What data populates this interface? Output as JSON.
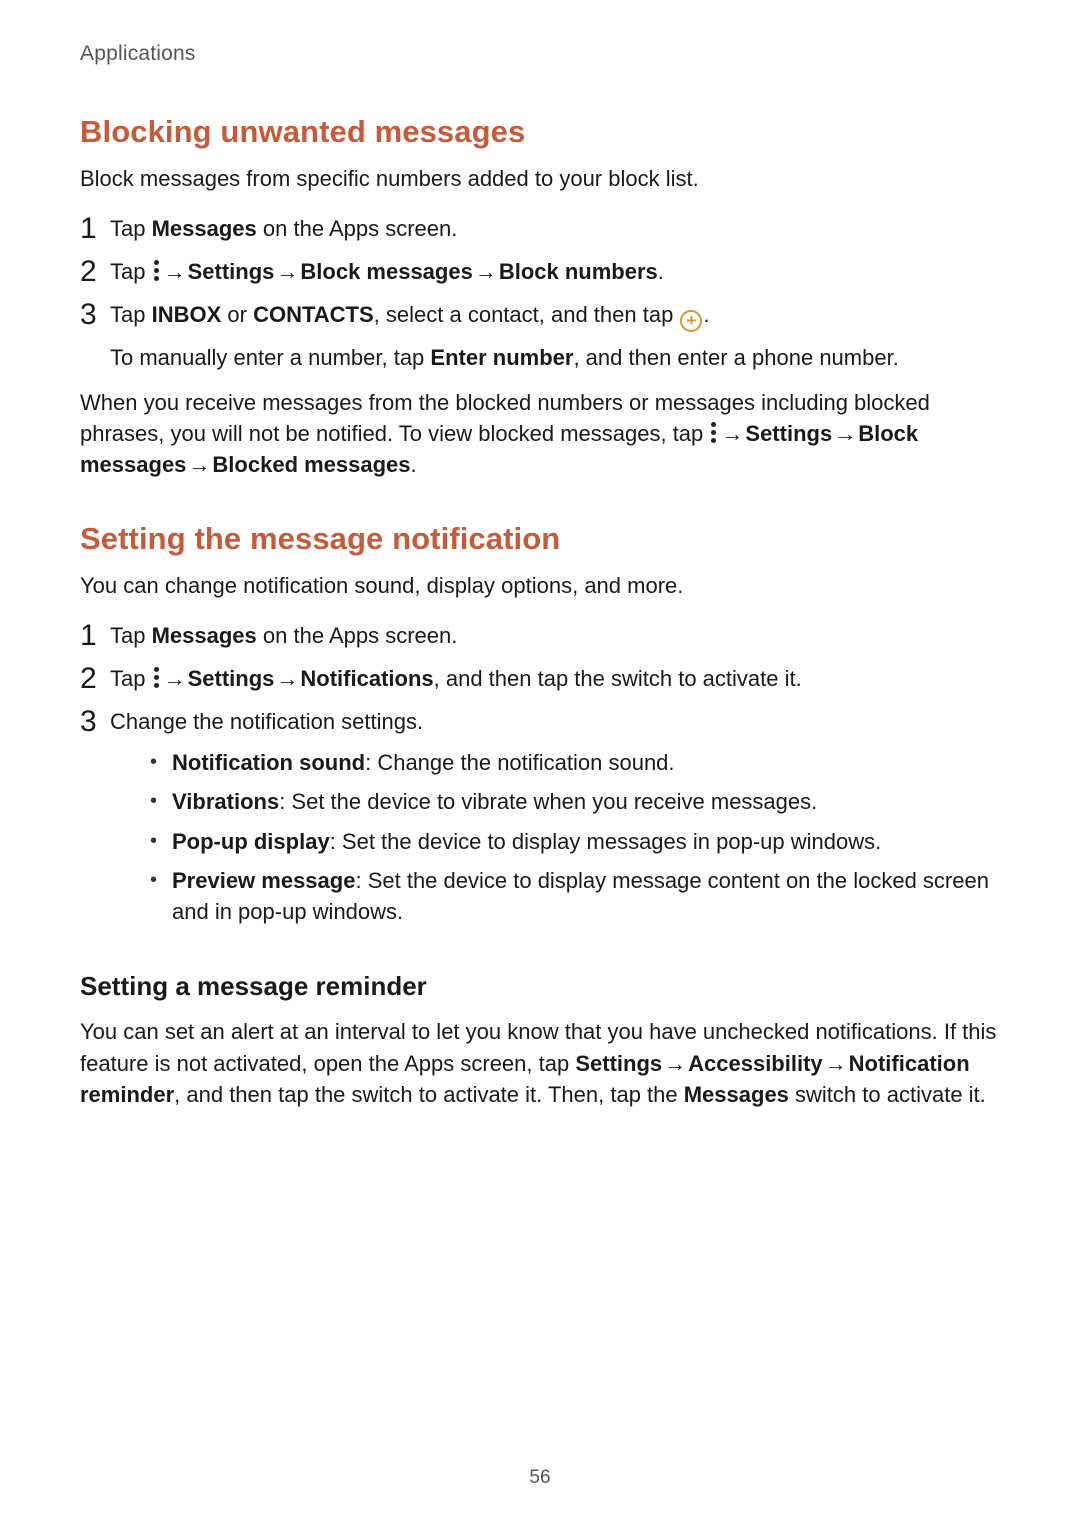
{
  "header": {
    "section": "Applications"
  },
  "section1": {
    "title": "Blocking unwanted messages",
    "lead": "Block messages from specific numbers added to your block list.",
    "step1": {
      "num": "1",
      "pre": "Tap ",
      "bold": "Messages",
      "post": " on the Apps screen."
    },
    "step2": {
      "num": "2",
      "pre": "Tap ",
      "arrow1": " → ",
      "b1": "Settings",
      "arrow2": " → ",
      "b2": "Block messages",
      "arrow3": " → ",
      "b3": "Block numbers",
      "end": "."
    },
    "step3": {
      "num": "3",
      "pre": "Tap ",
      "b1": "INBOX",
      "mid1": " or ",
      "b2": "CONTACTS",
      "mid2": ", select a contact, and then tap ",
      "end": ".",
      "sub_pre": "To manually enter a number, tap ",
      "sub_b": "Enter number",
      "sub_post": ", and then enter a phone number."
    },
    "follow": {
      "pre": "When you receive messages from the blocked numbers or messages including blocked phrases, you will not be notified. To view blocked messages, tap ",
      "arrow1": " → ",
      "b1": "Settings",
      "arrow2": " → ",
      "b2": "Block messages",
      "arrow3": " → ",
      "b3": "Blocked messages",
      "end": "."
    }
  },
  "section2": {
    "title": "Setting the message notification",
    "lead": "You can change notification sound, display options, and more.",
    "step1": {
      "num": "1",
      "pre": "Tap ",
      "bold": "Messages",
      "post": " on the Apps screen."
    },
    "step2": {
      "num": "2",
      "pre": "Tap ",
      "arrow1": " → ",
      "b1": "Settings",
      "arrow2": " → ",
      "b2": "Notifications",
      "post": ", and then tap the switch to activate it."
    },
    "step3": {
      "num": "3",
      "text": "Change the notification settings."
    },
    "bullets": {
      "b1_label": "Notification sound",
      "b1_text": ": Change the notification sound.",
      "b2_label": "Vibrations",
      "b2_text": ": Set the device to vibrate when you receive messages.",
      "b3_label": "Pop-up display",
      "b3_text": ": Set the device to display messages in pop-up windows.",
      "b4_label": "Preview message",
      "b4_text": ": Set the device to display message content on the locked screen and in pop-up windows."
    }
  },
  "section3": {
    "title": "Setting a message reminder",
    "p_pre": "You can set an alert at an interval to let you know that you have unchecked notifications. If this feature is not activated, open the Apps screen, tap ",
    "b1": "Settings",
    "arrow1": " → ",
    "b2": "Accessibility",
    "arrow2": " → ",
    "b3": "Notification reminder",
    "mid": ", and then tap the switch to activate it. Then, tap the ",
    "b4": "Messages",
    "post": " switch to activate it."
  },
  "page_number": "56"
}
